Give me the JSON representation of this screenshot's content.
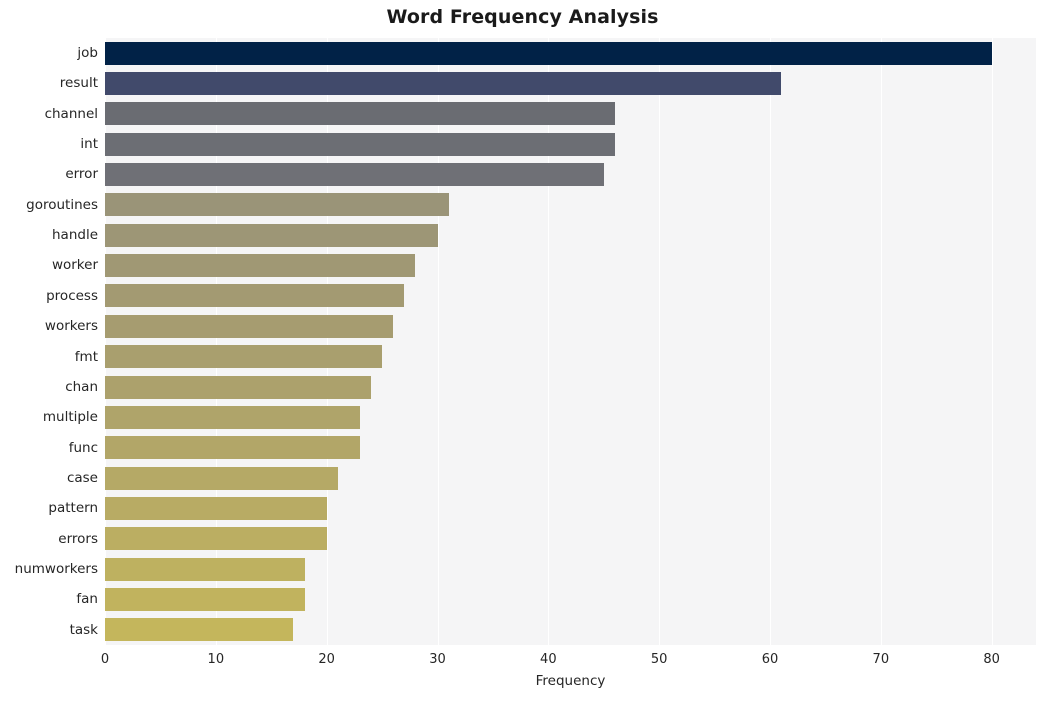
{
  "chart_data": {
    "type": "bar",
    "orientation": "horizontal",
    "title": "Word Frequency Analysis",
    "xlabel": "Frequency",
    "ylabel": "",
    "categories": [
      "job",
      "result",
      "channel",
      "int",
      "error",
      "goroutines",
      "handle",
      "worker",
      "process",
      "workers",
      "fmt",
      "chan",
      "multiple",
      "func",
      "case",
      "pattern",
      "errors",
      "numworkers",
      "fan",
      "task"
    ],
    "values": [
      80,
      61,
      46,
      46,
      45,
      31,
      30,
      28,
      27,
      26,
      25,
      24,
      23,
      23,
      21,
      20,
      20,
      18,
      18,
      17
    ],
    "bar_colors": [
      "#012247",
      "#414a6b",
      "#6a6c72",
      "#6c6e74",
      "#6f7076",
      "#9a9478",
      "#9d9676",
      "#a09874",
      "#a39a72",
      "#a69c70",
      "#a99f6e",
      "#aca16c",
      "#afa46a",
      "#b2a668",
      "#b5a966",
      "#b8ab64",
      "#bbae62",
      "#beb160",
      "#c1b35e",
      "#c4b65c"
    ],
    "xlim": [
      0,
      84
    ],
    "xticks": [
      0,
      10,
      20,
      30,
      40,
      50,
      60,
      70,
      80
    ],
    "xticklabels": [
      "0",
      "10",
      "20",
      "30",
      "40",
      "50",
      "60",
      "70",
      "80"
    ],
    "grid": true,
    "grid_axis": "x",
    "grid_color": "#ffffff",
    "plot_background": "#f5f5f6",
    "figure_background": "#ffffff",
    "legend": null,
    "colormap": "cividis"
  }
}
